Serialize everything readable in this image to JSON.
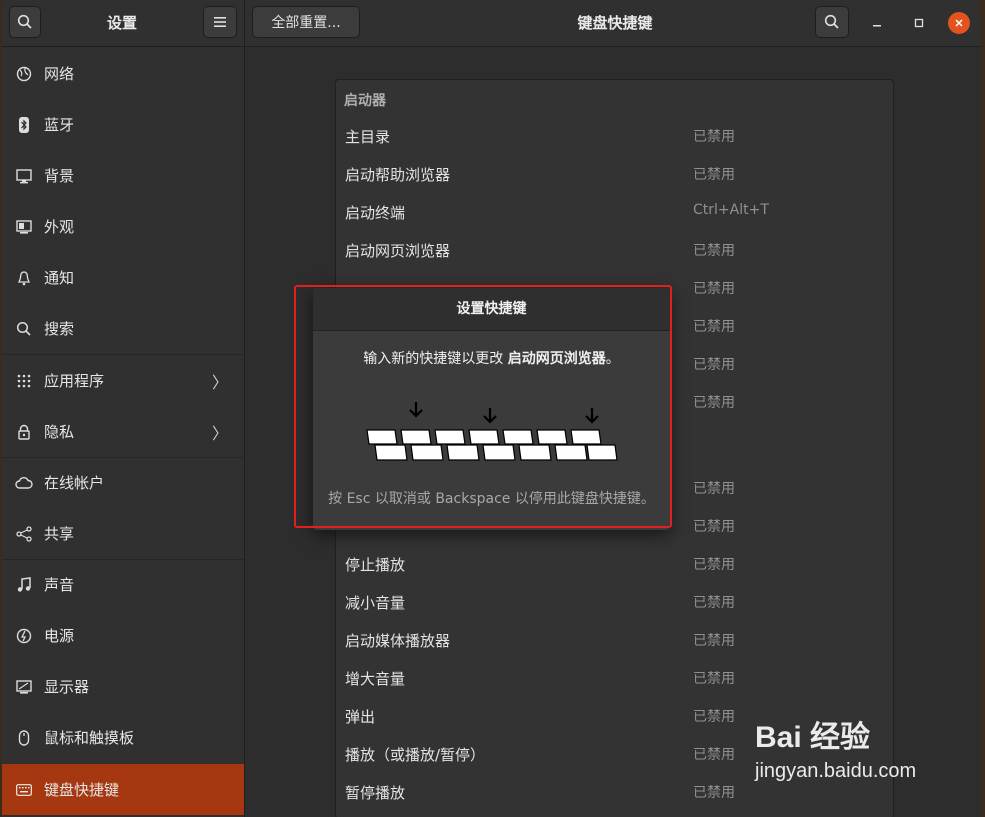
{
  "header": {
    "left_title": "设置",
    "reset_button": "全部重置...",
    "title": "键盘快捷键"
  },
  "sidebar": {
    "items": [
      {
        "label": "网络",
        "icon": "globe-icon"
      },
      {
        "label": "蓝牙",
        "icon": "bluetooth-icon"
      },
      {
        "label": "背景",
        "icon": "monitor-icon"
      },
      {
        "label": "外观",
        "icon": "appearance-icon"
      },
      {
        "label": "通知",
        "icon": "bell-icon"
      },
      {
        "label": "搜索",
        "icon": "search-icon"
      },
      {
        "label": "应用程序",
        "icon": "grid-icon",
        "chevron": true
      },
      {
        "label": "隐私",
        "icon": "lock-icon",
        "chevron": true
      },
      {
        "label": "在线帐户",
        "icon": "cloud-icon"
      },
      {
        "label": "共享",
        "icon": "share-icon"
      },
      {
        "label": "声音",
        "icon": "music-icon"
      },
      {
        "label": "电源",
        "icon": "power-icon"
      },
      {
        "label": "显示器",
        "icon": "display-icon"
      },
      {
        "label": "鼠标和触摸板",
        "icon": "mouse-icon"
      },
      {
        "label": "键盘快捷键",
        "icon": "keyboard-icon",
        "active": true
      }
    ]
  },
  "shortcuts": {
    "section": "启动器",
    "rows_top": [
      {
        "name": "主目录",
        "value": "已禁用"
      },
      {
        "name": "启动帮助浏览器",
        "value": "已禁用"
      },
      {
        "name": "启动终端",
        "value": "Ctrl+Alt+T"
      },
      {
        "name": "启动网页浏览器",
        "value": "已禁用"
      },
      {
        "name": "",
        "value": "已禁用"
      },
      {
        "name": "",
        "value": "已禁用"
      },
      {
        "name": "",
        "value": "已禁用"
      },
      {
        "name": "",
        "value": "已禁用"
      }
    ],
    "rows_bottom": [
      {
        "name": "",
        "value": "已禁用"
      },
      {
        "name": "",
        "value": "已禁用"
      },
      {
        "name": "停止播放",
        "value": "已禁用"
      },
      {
        "name": "减小音量",
        "value": "已禁用"
      },
      {
        "name": "启动媒体播放器",
        "value": "已禁用"
      },
      {
        "name": "增大音量",
        "value": "已禁用"
      },
      {
        "name": "弹出",
        "value": "已禁用"
      },
      {
        "name": "播放（或播放/暂停）",
        "value": "已禁用"
      },
      {
        "name": "暂停播放",
        "value": "已禁用"
      }
    ]
  },
  "dialog": {
    "title": "设置快捷键",
    "message_prefix": "输入新的快捷键以更改 ",
    "message_target": "启动网页浏览器",
    "message_suffix": "。",
    "hint": "按 Esc 以取消或 Backspace 以停用此键盘快捷键。"
  },
  "watermark": {
    "brand": "Bai 经验",
    "url": "jingyan.baidu.com"
  }
}
